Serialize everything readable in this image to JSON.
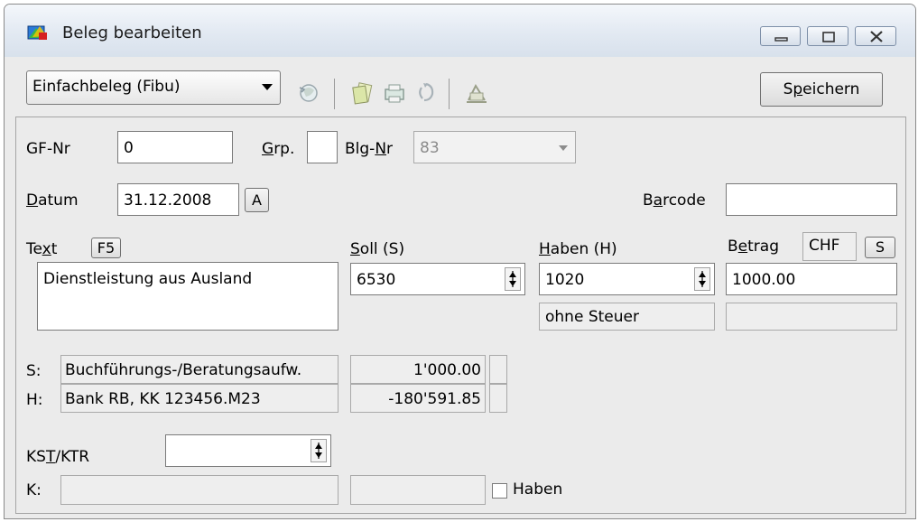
{
  "window": {
    "title": "Beleg bearbeiten"
  },
  "toolbar": {
    "beleg_type": "Einfachbeleg (Fibu)",
    "save_label_pre": "S",
    "save_label_u": "p",
    "save_label_post": "eichern"
  },
  "form": {
    "gf_nr_label": "GF-Nr",
    "gf_nr_value": "0",
    "grp_label_u": "G",
    "grp_label_rest": "rp.",
    "grp_value": "",
    "blg_nr_label_pre": "Blg-",
    "blg_nr_label_u": "N",
    "blg_nr_label_post": "r",
    "blg_nr_value": "83",
    "datum_label_u": "D",
    "datum_label_rest": "atum",
    "datum_value": "31.12.2008",
    "datum_button": "A",
    "barcode_label_pre": "B",
    "barcode_label_u": "a",
    "barcode_label_post": "rcode",
    "barcode_value": "",
    "text_label_pre": "Te",
    "text_label_u": "x",
    "text_label_post": "t",
    "text_key": "F5",
    "text_value": "Dienstleistung aus Ausland",
    "soll_label_u": "S",
    "soll_label_rest": "oll (S)",
    "soll_value": "6530",
    "haben_label_u": "H",
    "haben_label_rest": "aben (H)",
    "haben_value": "1020",
    "tax_value": "ohne Steuer",
    "betrag_label_pre": "B",
    "betrag_label_u": "e",
    "betrag_label_post": "trag",
    "currency": "CHF",
    "currency_button": "S",
    "betrag_value": "1000.00",
    "s_prefix": "S:",
    "s_account_name": "Buchführungs-/Beratungsaufw.",
    "s_balance": "1'000.00",
    "h_prefix": "H:",
    "h_account_name": "Bank RB, KK 123456.M23",
    "h_balance": "-180'591.85",
    "kst_label_pre": "KS",
    "kst_label_u": "T",
    "kst_label_post": "/KTR",
    "kst_value": "",
    "k_prefix": "K:",
    "k_name": "",
    "k_value": "",
    "haben_checkbox_label": "Haben",
    "haben_checkbox_checked": false
  },
  "icons": [
    "beleg-app-icon",
    "globe-refresh-icon",
    "copy-pages-icon",
    "print-icon",
    "recycle-icon",
    "scales-icon",
    "spin-arrows-icon"
  ],
  "colors": {
    "window_bg": "#ebebeb",
    "titlebar": "#dde5ef",
    "field_bg": "#ffffff",
    "readonly_bg": "#eeeeee"
  }
}
